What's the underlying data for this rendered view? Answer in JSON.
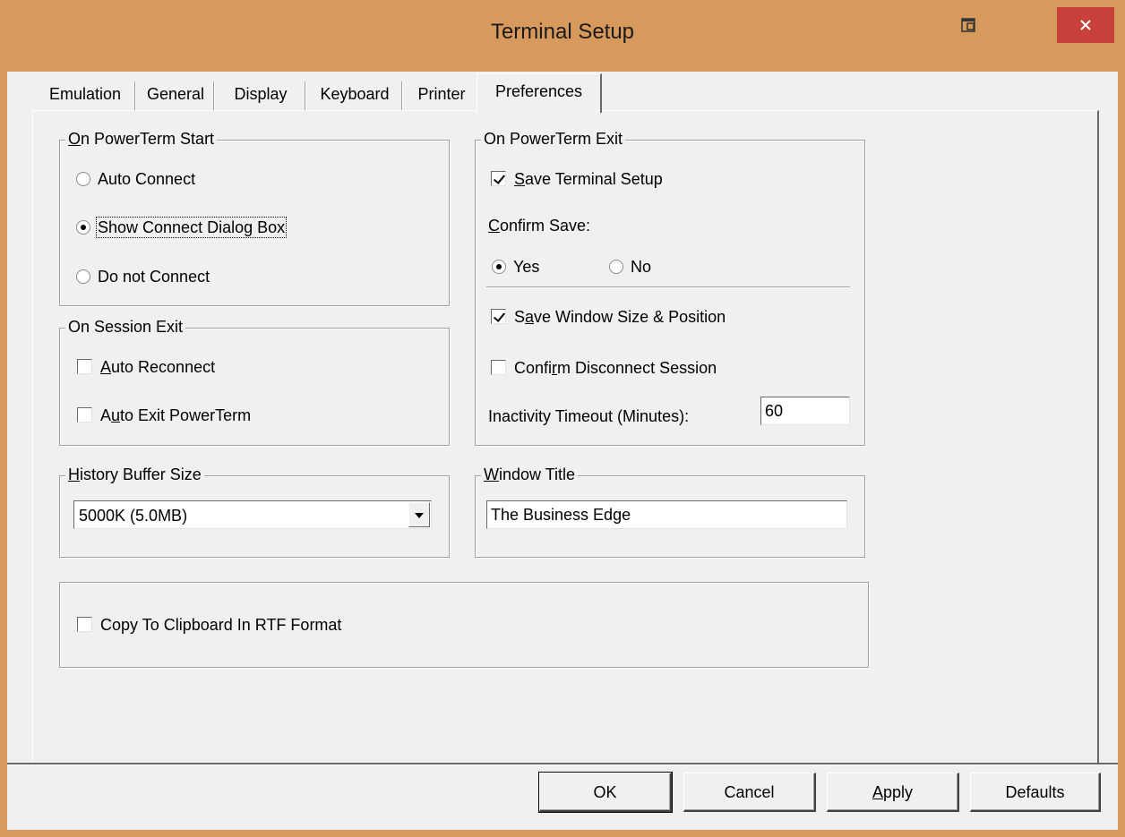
{
  "window": {
    "title": "Terminal Setup"
  },
  "tabs": [
    {
      "label": "Emulation"
    },
    {
      "label": "General"
    },
    {
      "label": "Display"
    },
    {
      "label": "Keyboard"
    },
    {
      "label": "Printer"
    },
    {
      "label": "Preferences",
      "selected": true
    }
  ],
  "on_start": {
    "legend": "On PowerTerm Start",
    "options": [
      {
        "label": "Auto Connect",
        "selected": false
      },
      {
        "label": "Show Connect Dialog Box",
        "selected": true
      },
      {
        "label": "Do not Connect",
        "selected": false
      }
    ]
  },
  "on_session_exit": {
    "legend": "On Session Exit",
    "auto_reconnect": {
      "label": "Auto Reconnect",
      "checked": false
    },
    "auto_exit": {
      "label": "Auto Exit PowerTerm",
      "checked": false
    }
  },
  "history": {
    "legend": "History Buffer Size",
    "value": "5000K  (5.0MB)"
  },
  "on_exit": {
    "legend": "On PowerTerm Exit",
    "save_setup": {
      "label": "Save Terminal Setup",
      "checked": true
    },
    "confirm_label": "Confirm Save:",
    "yes_label": "Yes",
    "no_label": "No",
    "confirm_value": "Yes",
    "save_window": {
      "label": "Save Window Size & Position",
      "checked": true
    },
    "confirm_disconnect": {
      "label": "Confirm Disconnect Session",
      "checked": false
    },
    "timeout_label": "Inactivity Timeout (Minutes):",
    "timeout_value": "60"
  },
  "window_title": {
    "legend": "Window Title",
    "value": "The Business Edge"
  },
  "clipboard": {
    "label": "Copy To Clipboard In RTF Format",
    "checked": false
  },
  "buttons": {
    "ok": "OK",
    "cancel": "Cancel",
    "apply": "Apply",
    "defaults": "Defaults"
  },
  "icons": {
    "restore": "restore-icon",
    "close": "close-icon"
  },
  "colors": {
    "title_bar": "#d89a5c",
    "close_button": "#c7413a",
    "dialog_face": "#f0f0f0"
  }
}
